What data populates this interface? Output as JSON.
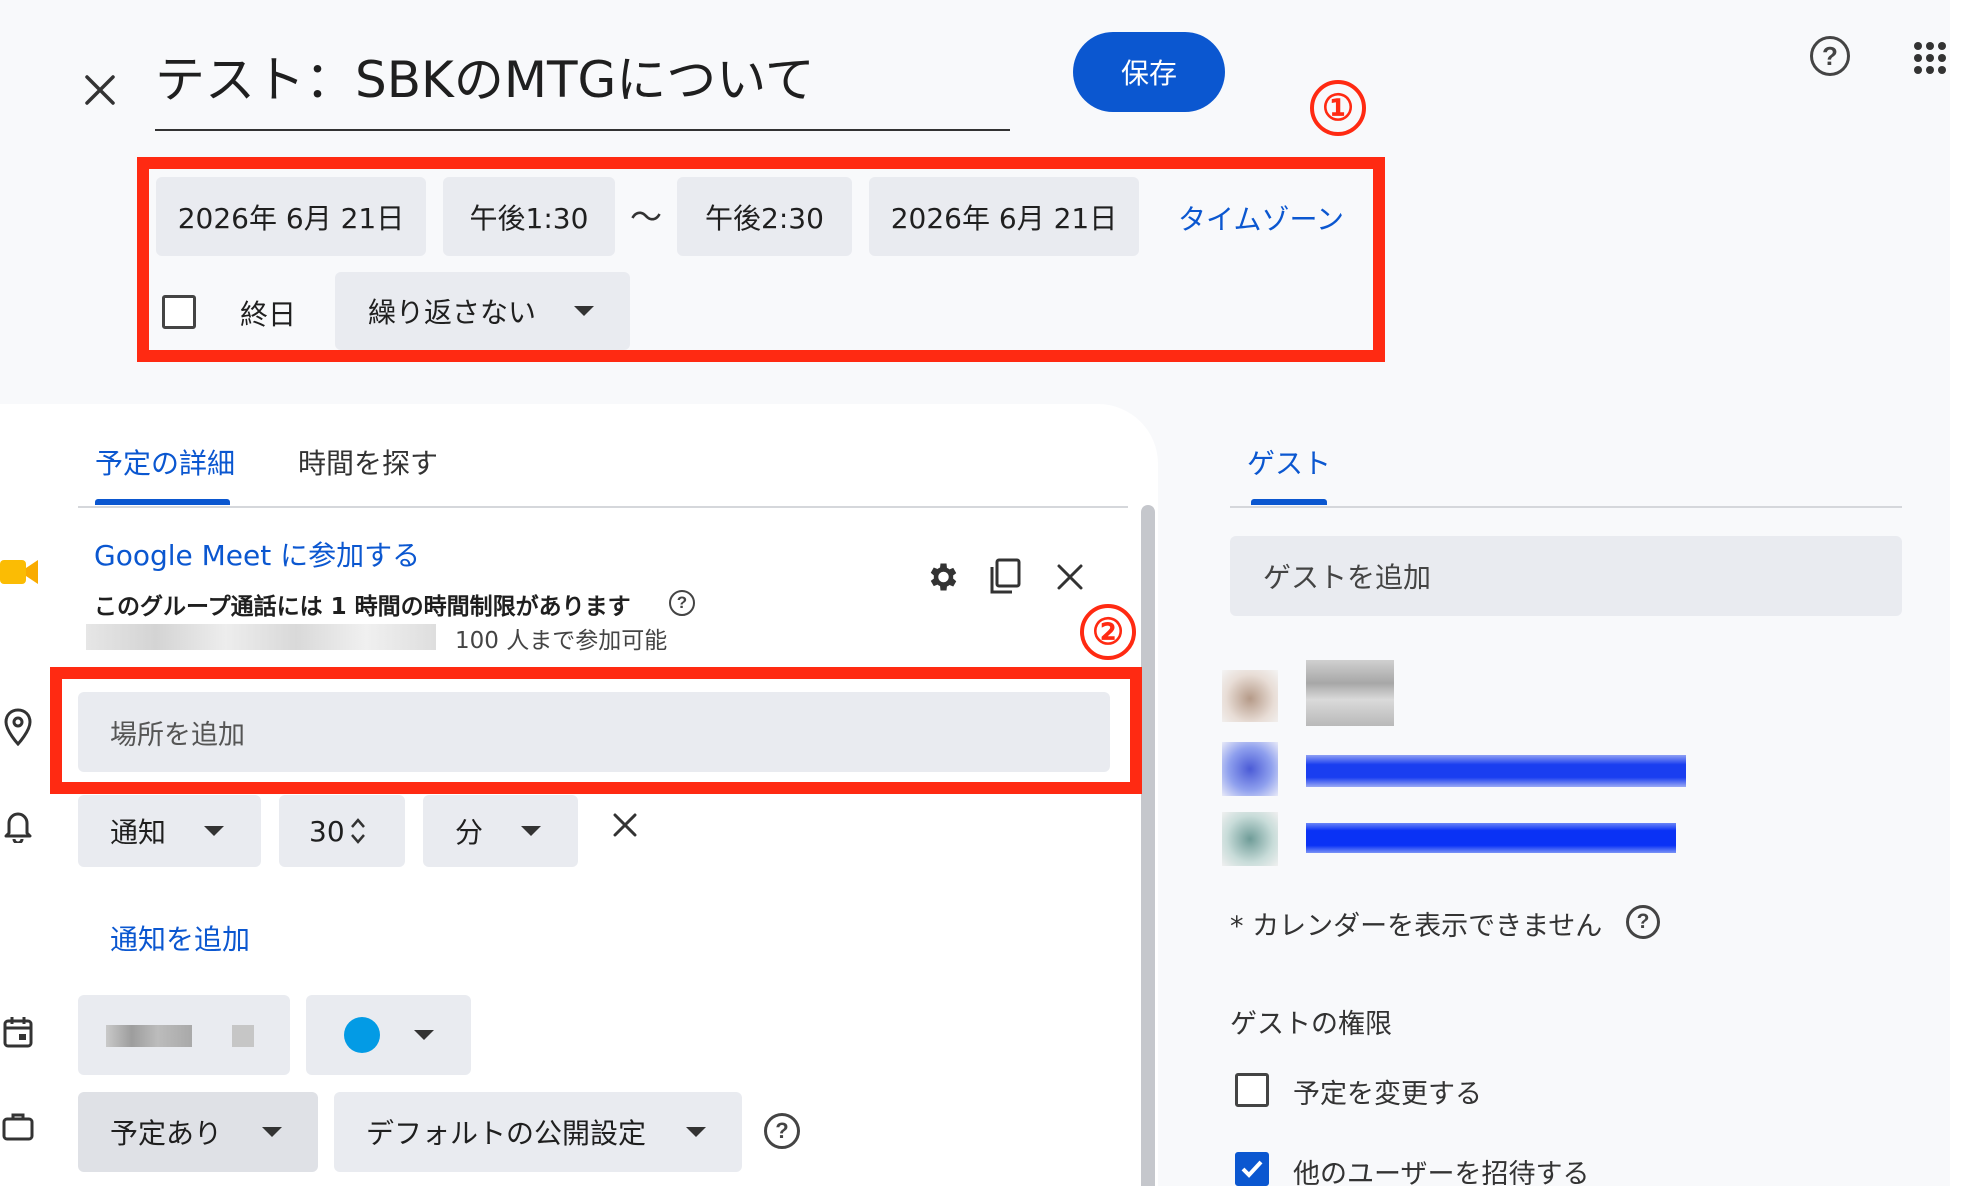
{
  "header": {
    "title": "テスト：SBKのMTGについて",
    "save_label": "保存"
  },
  "datetime": {
    "start_date": "2026年 6月 21日",
    "start_time": "午後1:30",
    "separator": "〜",
    "end_time": "午後2:30",
    "end_date": "2026年 6月 21日",
    "timezone_label": "タイムゾーン",
    "allday_label": "終日",
    "allday_checked": false,
    "repeat_label": "繰り返さない"
  },
  "annotations": {
    "marker_1": "①",
    "marker_2": "②",
    "color": "#ff2a12"
  },
  "tabs": [
    {
      "label": "予定の詳細",
      "active": true
    },
    {
      "label": "時間を探す",
      "active": false
    }
  ],
  "meet": {
    "join_label": "Google Meet に参加する",
    "limit_text": "このグループ通話には 1 時間の時間制限があります",
    "capacity_text": "100 人まで参加可能"
  },
  "location": {
    "placeholder": "場所を追加"
  },
  "notification": {
    "type_label": "通知",
    "value": "30",
    "unit_label": "分",
    "add_label": "通知を追加"
  },
  "calendar": {
    "color": "#039be5"
  },
  "status": {
    "availability_label": "予定あり",
    "visibility_label": "デフォルトの公開設定"
  },
  "guests": {
    "tab_label": "ゲスト",
    "add_placeholder": "ゲストを追加",
    "calendar_note": "* カレンダーを表示できません",
    "permissions_title": "ゲストの権限",
    "permissions": [
      {
        "label": "予定を変更する",
        "checked": false
      },
      {
        "label": "他のユーザーを招待する",
        "checked": true
      }
    ]
  },
  "colors": {
    "accent": "#0b57d0",
    "chip_bg": "#e9ebf0",
    "background": "#f8f9fb"
  }
}
